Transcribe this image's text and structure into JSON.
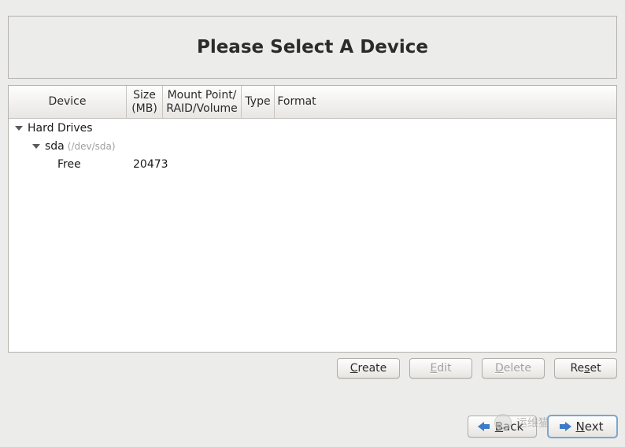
{
  "title": "Please Select A Device",
  "columns": {
    "device": "Device",
    "size": "Size\n(MB)",
    "mount": "Mount Point/\nRAID/Volume",
    "type": "Type",
    "format": "Format"
  },
  "tree": {
    "hard_drives_label": "Hard Drives",
    "sda": {
      "label": "sda",
      "path": "(/dev/sda)",
      "children": [
        {
          "label": "Free",
          "size": "20473",
          "mount": "",
          "type": "",
          "format": ""
        }
      ]
    }
  },
  "buttons": {
    "create": {
      "pre": "",
      "u": "C",
      "post": "reate",
      "enabled": true
    },
    "edit": {
      "pre": "",
      "u": "E",
      "post": "dit",
      "enabled": false
    },
    "delete": {
      "pre": "",
      "u": "D",
      "post": "elete",
      "enabled": false
    },
    "reset": {
      "pre": "Re",
      "u": "s",
      "post": "et",
      "enabled": true
    }
  },
  "nav": {
    "back": {
      "pre": "",
      "u": "B",
      "post": "ack"
    },
    "next": {
      "pre": "",
      "u": "N",
      "post": "ext"
    }
  },
  "watermark": "运维猫"
}
